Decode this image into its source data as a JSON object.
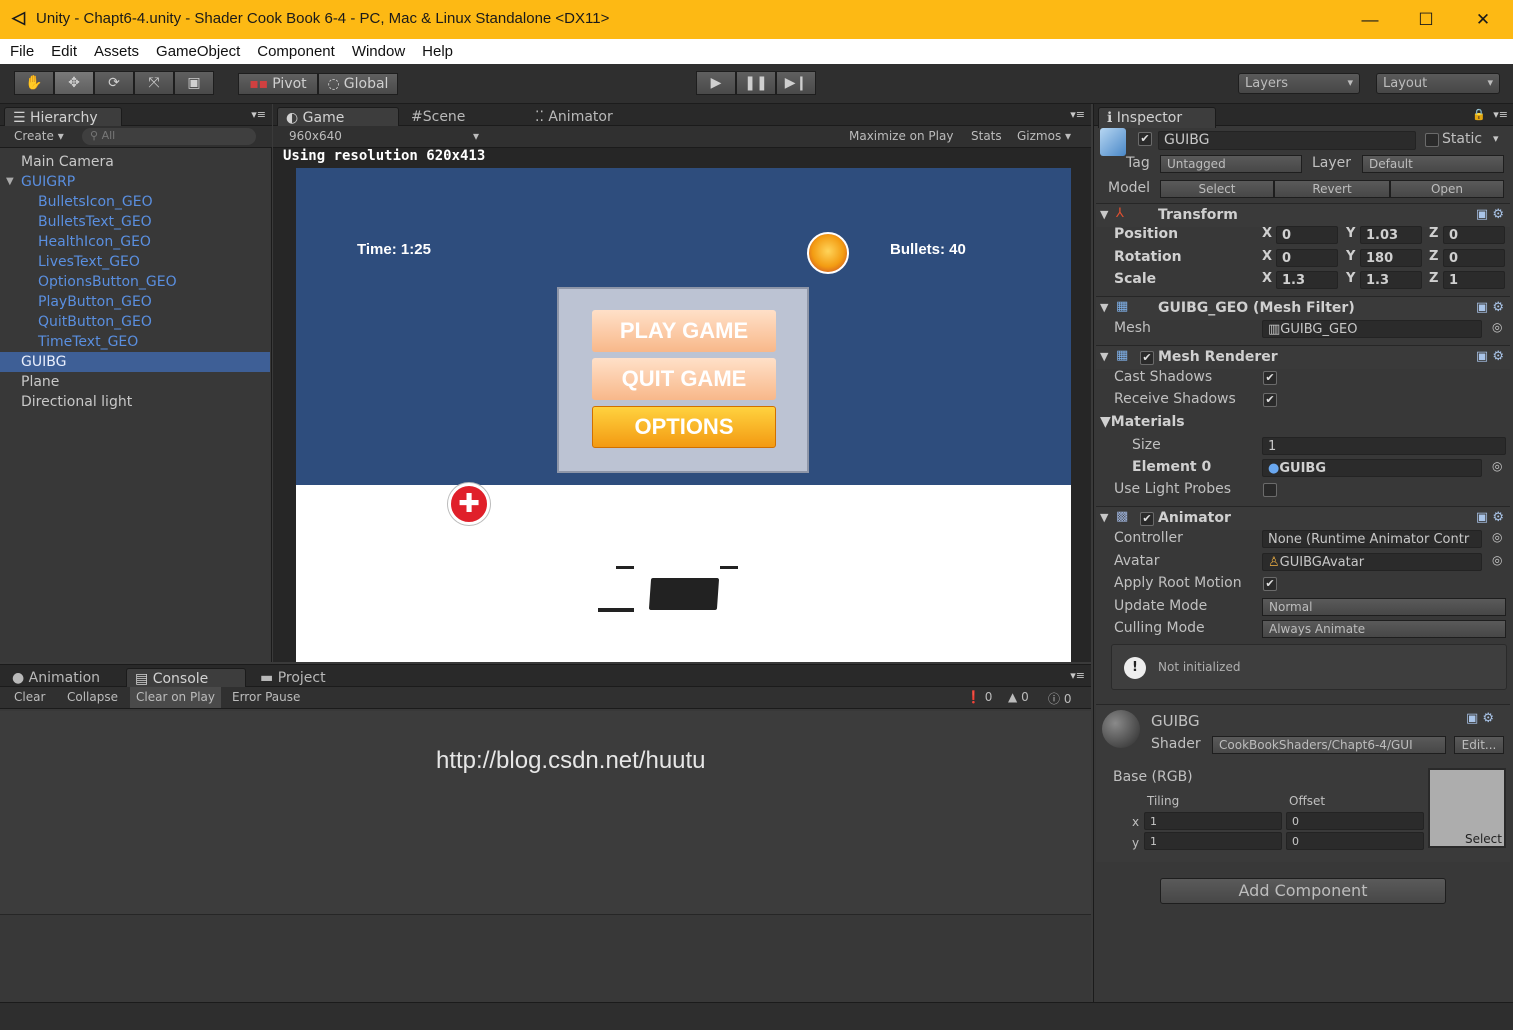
{
  "window": {
    "title": "Unity - Chapt6-4.unity - Shader Cook Book 6-4 - PC, Mac & Linux Standalone <DX11>"
  },
  "menu": [
    "File",
    "Edit",
    "Assets",
    "GameObject",
    "Component",
    "Window",
    "Help"
  ],
  "toolbar": {
    "pivot": "Pivot",
    "global": "Global",
    "layers": "Layers",
    "layout": "Layout"
  },
  "hierarchy": {
    "tab": "Hierarchy",
    "create": "Create",
    "search": "All",
    "items": [
      {
        "label": "Main Camera",
        "kind": "root"
      },
      {
        "label": "GUIGRP",
        "kind": "grp"
      },
      {
        "label": "BulletsIcon_GEO",
        "kind": "child"
      },
      {
        "label": "BulletsText_GEO",
        "kind": "child"
      },
      {
        "label": "HealthIcon_GEO",
        "kind": "child"
      },
      {
        "label": "LivesText_GEO",
        "kind": "child"
      },
      {
        "label": "OptionsButton_GEO",
        "kind": "child"
      },
      {
        "label": "PlayButton_GEO",
        "kind": "child"
      },
      {
        "label": "QuitButton_GEO",
        "kind": "child"
      },
      {
        "label": "TimeText_GEO",
        "kind": "child"
      },
      {
        "label": "GUIBG",
        "kind": "sel"
      },
      {
        "label": "Plane",
        "kind": "root"
      },
      {
        "label": "Directional light",
        "kind": "root"
      }
    ]
  },
  "game": {
    "tabs": {
      "game": "Game",
      "scene": "Scene",
      "animator": "Animator"
    },
    "resolution": "960x640",
    "options": [
      "Maximize on Play",
      "Stats",
      "Gizmos"
    ],
    "notice": "Using resolution 620x413",
    "time": "Time: 1:25",
    "bullets": "Bullets: 40",
    "buttons": [
      "PLAY GAME",
      "QUIT GAME",
      "OPTIONS"
    ]
  },
  "bottom": {
    "tabs": {
      "animation": "Animation",
      "console": "Console",
      "project": "Project"
    },
    "buttons": [
      "Clear",
      "Collapse",
      "Clear on Play",
      "Error Pause"
    ],
    "counts": {
      "errors": "0",
      "warnings": "0",
      "infos": "0"
    },
    "watermark": "http://blog.csdn.net/huutu"
  },
  "inspector": {
    "tab": "Inspector",
    "name": "GUIBG",
    "static": "Static",
    "tag_label": "Tag",
    "tag": "Untagged",
    "layer_label": "Layer",
    "layer": "Default",
    "model_label": "Model",
    "model_buttons": [
      "Select",
      "Revert",
      "Open"
    ],
    "transform": {
      "title": "Transform",
      "position": {
        "label": "Position",
        "x": "0",
        "y": "1.03",
        "z": "0"
      },
      "rotation": {
        "label": "Rotation",
        "x": "0",
        "y": "180",
        "z": "0"
      },
      "scale": {
        "label": "Scale",
        "x": "1.3",
        "y": "1.3",
        "z": "1"
      }
    },
    "meshfilter": {
      "title": "GUIBG_GEO (Mesh Filter)",
      "mesh_label": "Mesh",
      "mesh": "GUIBG_GEO"
    },
    "meshrenderer": {
      "title": "Mesh Renderer",
      "cast": "Cast Shadows",
      "receive": "Receive Shadows",
      "materials": "Materials",
      "size_label": "Size",
      "size": "1",
      "element_label": "Element 0",
      "element": "GUIBG",
      "probes": "Use Light Probes"
    },
    "animator": {
      "title": "Animator",
      "controller_label": "Controller",
      "controller": "None (Runtime Animator Contr",
      "avatar_label": "Avatar",
      "avatar": "GUIBGAvatar",
      "root_motion": "Apply Root Motion",
      "update_label": "Update Mode",
      "update": "Normal",
      "culling_label": "Culling Mode",
      "culling": "Always Animate",
      "notice": "Not initialized"
    },
    "material": {
      "name": "GUIBG",
      "shader_label": "Shader",
      "shader": "CookBookShaders/Chapt6-4/GUI",
      "edit": "Edit...",
      "base": "Base (RGB)",
      "tiling": "Tiling",
      "offset": "Offset",
      "x_label": "x",
      "y_label": "y",
      "tx": "1",
      "ty": "1",
      "ox": "0",
      "oy": "0",
      "select": "Select"
    },
    "add_component": "Add Component"
  },
  "colors": {
    "title_bar": "#fdb914",
    "selection": "#3e5f96",
    "game_sky": "#2e4d7d",
    "game_floor": "#ffffff",
    "button_orange": "#f6a31f"
  }
}
